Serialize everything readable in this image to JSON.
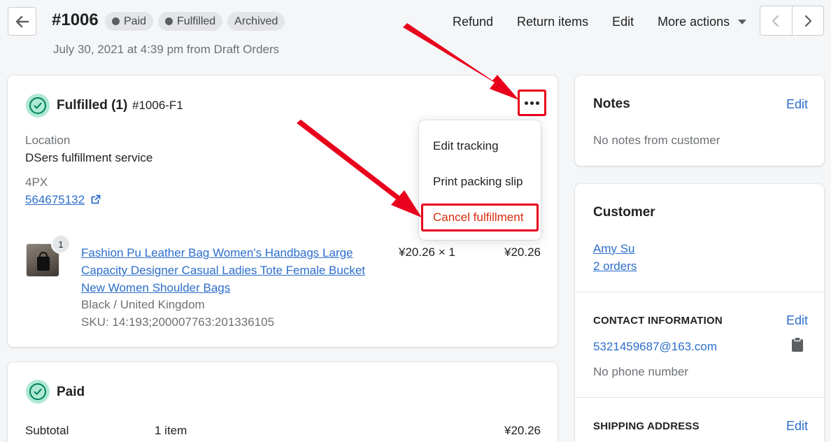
{
  "header": {
    "order_number": "#1006",
    "badges": [
      {
        "label": "Paid",
        "has_dot": true
      },
      {
        "label": "Fulfilled",
        "has_dot": true
      },
      {
        "label": "Archived",
        "has_dot": false
      }
    ],
    "subtitle": "July 30, 2021 at 4:39 pm from Draft Orders",
    "actions": {
      "refund": "Refund",
      "return_items": "Return items",
      "edit": "Edit",
      "more_actions": "More actions"
    }
  },
  "fulfilled_card": {
    "title": "Fulfilled",
    "count": "(1)",
    "fulfillment_id": "#1006-F1",
    "location_label": "Location",
    "location_value": "DSers fulfillment service",
    "carrier": "4PX",
    "tracking_number": "564675132",
    "menu": {
      "edit_tracking": "Edit tracking",
      "print_packing_slip": "Print packing slip",
      "cancel_fulfillment": "Cancel fulfillment"
    },
    "line_item": {
      "quantity_badge": "1",
      "title": "Fashion Pu Leather Bag Women's Handbags Large Capacity Designer Casual Ladies Tote Female Bucket New Women Shoulder Bags",
      "variant": "Black / United Kingdom",
      "sku": "SKU: 14:193;200007763:201336105",
      "unit_price_qty": "¥20.26 × 1",
      "total": "¥20.26"
    }
  },
  "paid_card": {
    "title": "Paid",
    "subtotal_label": "Subtotal",
    "subtotal_items": "1 item",
    "subtotal_value": "¥20.26"
  },
  "notes_card": {
    "title": "Notes",
    "edit": "Edit",
    "body": "No notes from customer"
  },
  "customer_card": {
    "title": "Customer",
    "name": "Amy Su",
    "orders": "2 orders",
    "contact_label": "CONTACT INFORMATION",
    "contact_edit": "Edit",
    "email": "5321459687@163.com",
    "phone": "No phone number",
    "shipping_label": "SHIPPING ADDRESS",
    "shipping_edit": "Edit"
  },
  "colors": {
    "accent_link": "#2c6ecb",
    "success_bg": "#aee9d1",
    "success_icon": "#007f5f",
    "annotation_red": "#e8001c",
    "destructive_text": "#d72c0d"
  },
  "icons": {
    "back": "arrow-left-icon",
    "prev": "chevron-left-icon",
    "next": "chevron-right-icon",
    "external": "external-link-icon",
    "check": "check-circle-icon",
    "more": "horizontal-dots-icon",
    "clipboard": "clipboard-icon"
  }
}
